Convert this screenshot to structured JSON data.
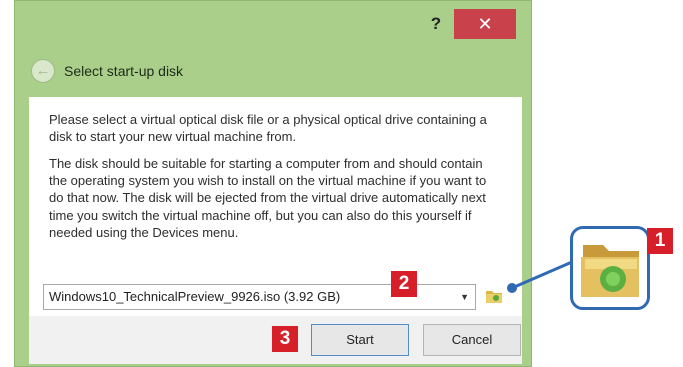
{
  "window": {
    "help_label": "?",
    "close_label": "✕",
    "back_icon": "arrow-left-icon",
    "heading": "Select start-up disk"
  },
  "content": {
    "para1": "Please select a virtual optical disk file or a physical optical drive containing a disk to start your new virtual machine from.",
    "para2": "The disk should be suitable for starting a computer from and should contain the operating system you wish to install on the virtual machine if you want to do that now. The disk will be ejected from the virtual drive automatically next time you switch the virtual machine off, but you can also do this yourself if needed using the Devices menu."
  },
  "disk_select": {
    "selected_value": "Windows10_TechnicalPreview_9926.iso (3.92 GB)",
    "arrow": "▼",
    "folder_icon": "folder-icon"
  },
  "footer": {
    "start_label": "Start",
    "cancel_label": "Cancel"
  },
  "callouts": {
    "badge1": "1",
    "badge2": "2",
    "badge3": "3"
  },
  "colors": {
    "dialog_accent": "#a9cf8a",
    "close_button": "#c9424b",
    "callout_badge": "#d71f2a",
    "callout_line": "#2f6ab3"
  }
}
